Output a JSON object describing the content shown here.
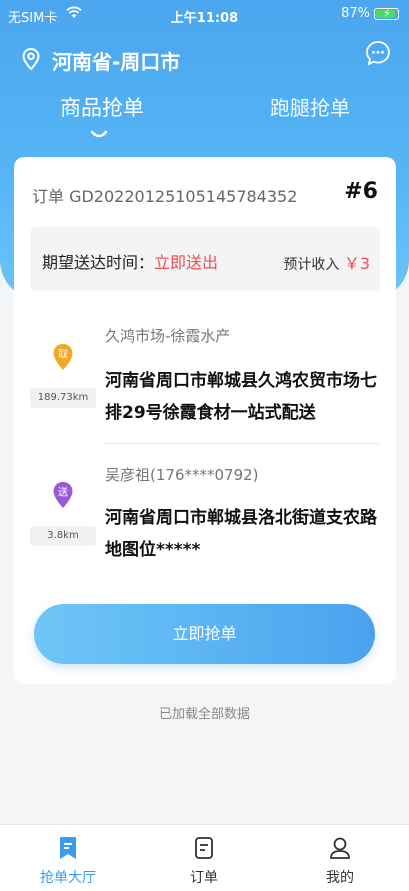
{
  "status": {
    "carrier": "无SIM卡",
    "time": "上午11:08",
    "battery": "87%"
  },
  "header": {
    "location": "河南省-周口市"
  },
  "tabs": [
    {
      "label": "商品抢单",
      "active": true
    },
    {
      "label": "跑腿抢单",
      "active": false
    }
  ],
  "order": {
    "number_label": "订单 GD20220125105145784352",
    "index": "#6",
    "expect_label": "期望送达时间：",
    "expect_value": "立即送出",
    "income_label": "预计收入",
    "income_value": "￥3"
  },
  "pickup": {
    "badge": "取",
    "distance": "189.73km",
    "name": "久鸿市场-徐霞水产",
    "address": "河南省周口市郸城县久鸿农贸市场七排29号徐霞食材一站式配送"
  },
  "delivery": {
    "badge": "送",
    "distance": "3.8km",
    "name": "吴彦祖(176****0792)",
    "address": "河南省周口市郸城县洛北街道支农路地图位*****"
  },
  "grab_button": "立即抢单",
  "loaded_text": "已加载全部数据",
  "bottom_nav": [
    {
      "label": "抢单大厅",
      "icon": "bookmark-icon",
      "active": true
    },
    {
      "label": "订单",
      "icon": "document-icon",
      "active": false
    },
    {
      "label": "我的",
      "icon": "user-icon",
      "active": false
    }
  ],
  "colors": {
    "primary": "#4aa6ee",
    "accent_red": "#f0504c",
    "pickup_pin": "#f5a623",
    "delivery_pin": "#9b59d9"
  }
}
